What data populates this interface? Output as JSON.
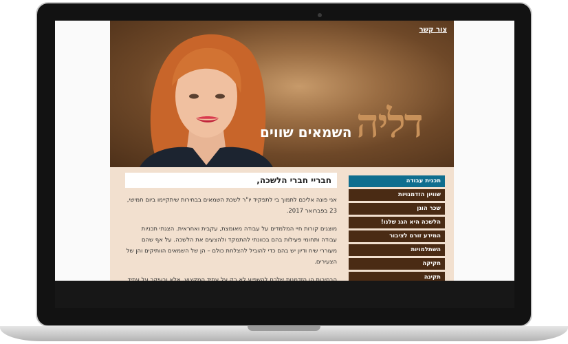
{
  "header": {
    "contact_link": "צור קשר",
    "logo_word": "דליה",
    "logo_sub": "השמאים שווים"
  },
  "content": {
    "title": "חבריי חברי הלשכה,",
    "paragraphs": [
      "אני פונה אליכם לתמוך בי לתפקיד יו\"ר לשכת השמאים בבחירות שיתקיימו ביום חמישי, 23 בפברואר 2017.",
      "מוצגים קורות חיי המלמדים על עבודה מאומצת, עקבית ואחראית. הצגתי תכניות עבודה ותחומי פעילות בהם בכוונתי להתמקד ולהצעים את הלשכה. על אף שהם מעוררי שיח ודיון יש בהם כדי להוביל להצלחת כולם – הן של השמאים הוותיקים והן של הצעירים.",
      "הבחירות הן הזדמנות שלכם להשפיע לא רק על עתיד המקצוע, אלא ובעיקר על עתיד הפרנסה שלכם כשמאים. פעם בשלוש שנים ניתנת בידיכם הזכות להשפיע, לחדש, לבחון הישגים ואני מוכנה להיענות גם לאתגר זה."
    ]
  },
  "menu": {
    "items": [
      {
        "label": "תכנית עבודה",
        "active": true
      },
      {
        "label": "שוויון הזדמנויות",
        "active": false
      },
      {
        "label": "שכר הוגן",
        "active": false
      },
      {
        "label": "הלשכה היא הגג שלנו!",
        "active": false
      },
      {
        "label": "המידע זורם לציבור",
        "active": false
      },
      {
        "label": "השתלמויות",
        "active": false
      },
      {
        "label": "חקיקה",
        "active": false
      },
      {
        "label": "תקינה",
        "active": false
      }
    ]
  },
  "colors": {
    "menu_bg": "#4a2b14",
    "menu_active": "#0f6e8f",
    "content_bg": "#f2e0cf",
    "logo_color": "#c8915a"
  }
}
